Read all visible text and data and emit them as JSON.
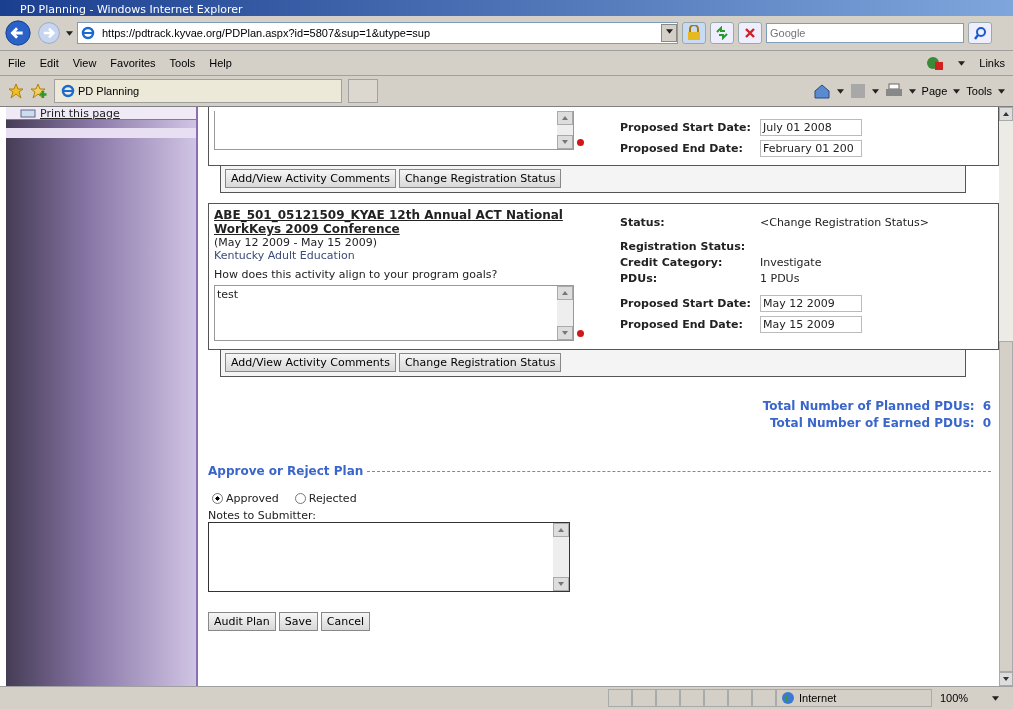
{
  "window": {
    "title": "PD Planning - Windows Internet Explorer"
  },
  "address": {
    "url": "https://pdtrack.kyvae.org/PDPlan.aspx?id=5807&sup=1&utype=sup"
  },
  "search": {
    "placeholder": "Google"
  },
  "menu": [
    "File",
    "Edit",
    "View",
    "Favorites",
    "Tools",
    "Help"
  ],
  "links": "Links",
  "tab": {
    "title": "PD Planning"
  },
  "commands": [
    "Page",
    "Tools"
  ],
  "sidebar": {
    "link": "Print this page"
  },
  "activities": [
    {
      "kind": "partial",
      "fields": [
        {
          "label": "Proposed Start Date:",
          "value": "July 01 2008",
          "kind": "input"
        },
        {
          "label": "Proposed End Date:",
          "value": "February 01 200",
          "kind": "input"
        }
      ],
      "buttons": [
        "Add/View Activity Comments",
        "Change Registration Status"
      ]
    },
    {
      "kind": "full",
      "title": "ABE_501_05121509_KYAE 12th Annual ACT National WorkKeys 2009 Conference",
      "dates": "(May 12 2009 - May 15 2009)",
      "provider": "Kentucky Adult Education",
      "question": "How does this activity align to your program goals?",
      "answer": "test",
      "status": [
        {
          "label": "Status:",
          "value": "<Change Registration Status>"
        },
        {
          "label": "Registration Status:"
        },
        {
          "label": "Credit Category:",
          "value": "Investigate"
        },
        {
          "label": "PDUs:",
          "value": "1 PDUs"
        }
      ],
      "fields": [
        {
          "label": "Proposed Start Date:",
          "value": "May 12 2009",
          "kind": "input"
        },
        {
          "label": "Proposed End Date:",
          "value": "May 15 2009",
          "kind": "input"
        }
      ],
      "buttons": [
        "Add/View Activity Comments",
        "Change Registration Status"
      ]
    }
  ],
  "totals": [
    {
      "label": "Total Number of Planned PDUs:",
      "value": "6"
    },
    {
      "label": "Total Number of Earned PDUs:",
      "value": "0"
    }
  ],
  "approval": {
    "heading": "Approve or Reject Plan",
    "options": [
      {
        "label": "Approved",
        "selected": true
      },
      {
        "label": "Rejected",
        "selected": false
      }
    ],
    "notes_label": "Notes to Submitter:"
  },
  "buttons": [
    "Audit Plan",
    "Save",
    "Cancel"
  ],
  "status_bar": {
    "zone": "Internet",
    "zoom": "100%"
  }
}
